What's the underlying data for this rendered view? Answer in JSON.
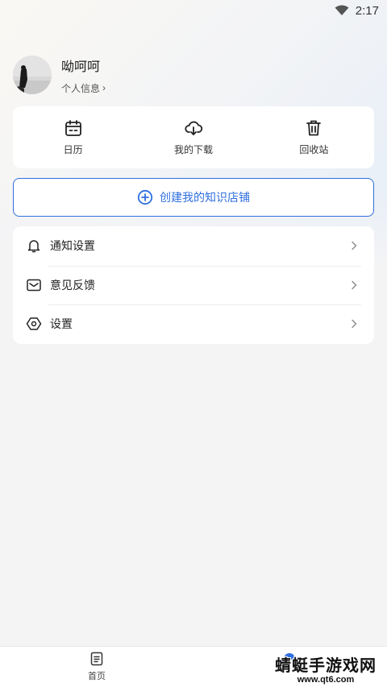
{
  "status_bar": {
    "time": "2:17",
    "wifi_icon": "wifi-icon"
  },
  "profile": {
    "username": "呦呵呵",
    "link_label": "个人信息",
    "link_chevron": "›"
  },
  "quick_actions": [
    {
      "label": "日历",
      "icon": "calendar-icon"
    },
    {
      "label": "我的下载",
      "icon": "download-icon"
    },
    {
      "label": "回收站",
      "icon": "trash-icon"
    }
  ],
  "create_shop": {
    "label": "创建我的知识店铺",
    "icon": "plus-circle-icon"
  },
  "menu": [
    {
      "label": "通知设置",
      "icon": "bell-icon"
    },
    {
      "label": "意见反馈",
      "icon": "mail-icon"
    },
    {
      "label": "设置",
      "icon": "settings-hexagon-icon"
    }
  ],
  "tabbar": {
    "home_label": "首页",
    "home_icon": "document-icon"
  },
  "watermark": {
    "main": "蜻蜓手游戏网",
    "sub": "www.qt6.com"
  },
  "colors": {
    "accent": "#2f6fdf",
    "background": "#f4f4f5",
    "card": "#ffffff"
  }
}
